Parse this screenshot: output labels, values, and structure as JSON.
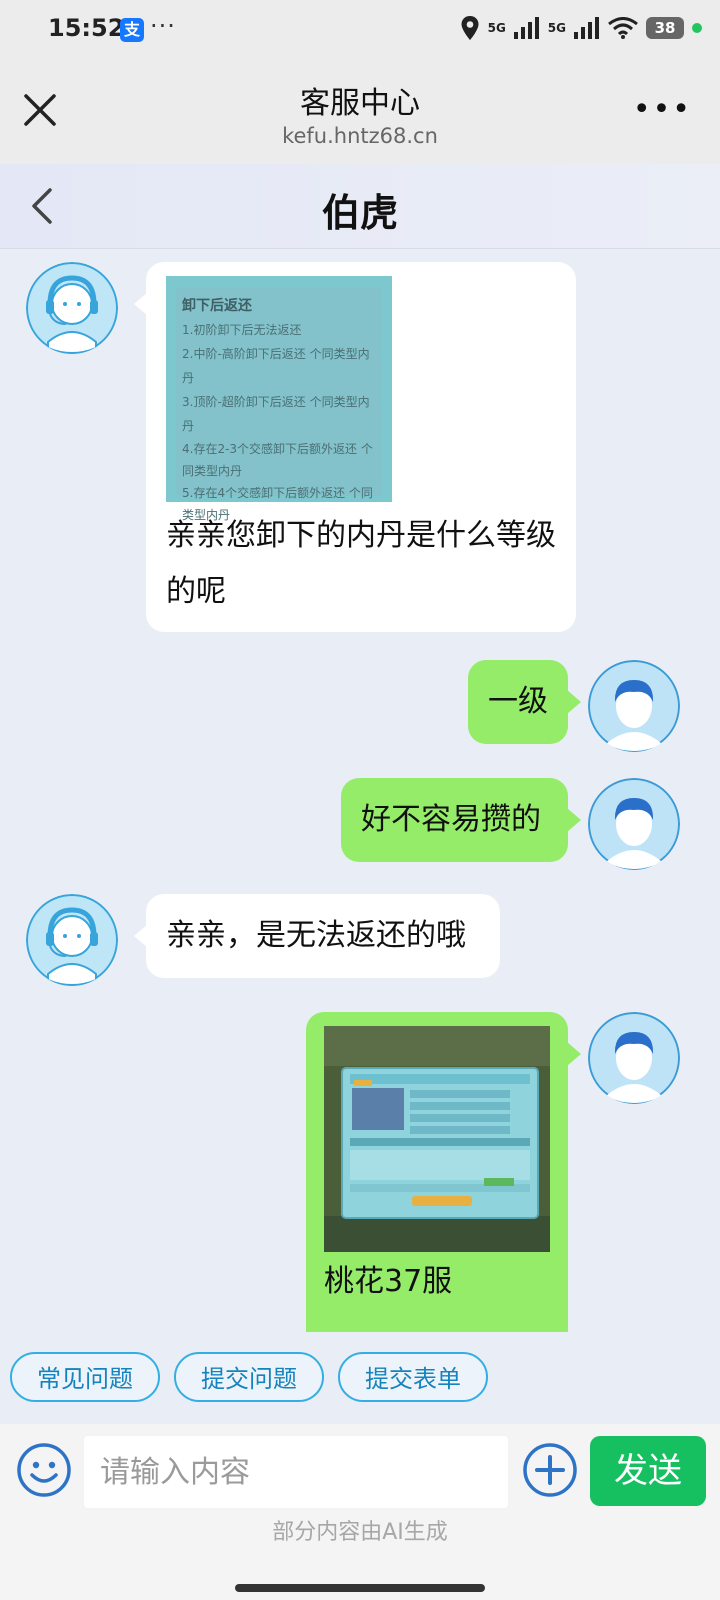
{
  "status_bar": {
    "time": "15:52",
    "app_icon": "alipay-icon",
    "more": "···",
    "network": "5G",
    "battery": "38"
  },
  "browser": {
    "title": "客服中心",
    "url": "kefu.hntz68.cn"
  },
  "page": {
    "title": "伯虎"
  },
  "messages": [
    {
      "from": "agent",
      "image": {
        "title": "卸下后返还",
        "lines": [
          "1.初阶卸下后无法返还",
          "2.中阶-高阶卸下后返还 个同类型内丹",
          "3.顶阶-超阶卸下后返还 个同类型内丹",
          "4.存在2-3个交感卸下后额外返还 个同类型内丹",
          "5.存在4个交感卸下后额外返还 个同类型内丹"
        ]
      },
      "text": "亲亲您卸下的内丹是什么等级的呢"
    },
    {
      "from": "user",
      "text": "一级"
    },
    {
      "from": "user",
      "text": "好不容易攒的"
    },
    {
      "from": "agent",
      "text": "亲亲，是无法返还的哦"
    },
    {
      "from": "user",
      "text": "桃花37服"
    }
  ],
  "quick_actions": [
    "常见问题",
    "提交问题",
    "提交表单"
  ],
  "input": {
    "placeholder": "请输入内容",
    "send_label": "发送"
  },
  "footer_note": "部分内容由AI生成"
}
